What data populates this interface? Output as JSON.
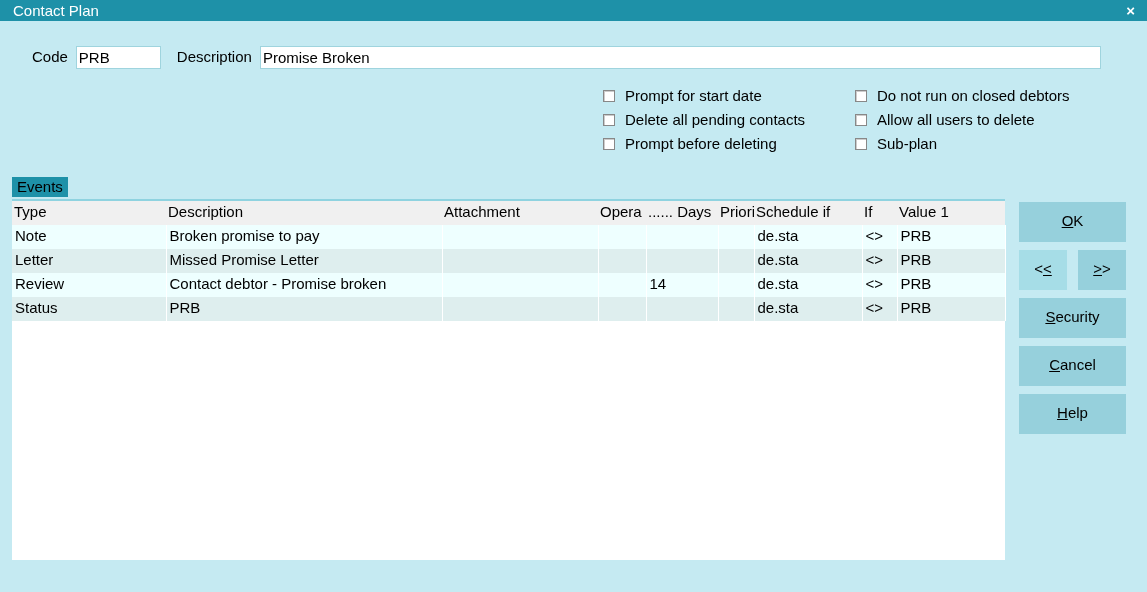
{
  "window": {
    "title": "Contact Plan",
    "close": "×"
  },
  "fields": [
    {
      "label": "Code",
      "value": "PRB"
    },
    {
      "label": "Description",
      "value": "Promise Broken"
    }
  ],
  "options": [
    [
      {
        "label": "Prompt for start date",
        "checked": false
      },
      {
        "label": "Delete all pending contacts",
        "checked": false
      },
      {
        "label": "Prompt before deleting",
        "checked": false
      }
    ],
    [
      {
        "label": "Do not run on closed debtors",
        "checked": false
      },
      {
        "label": "Allow all users to delete",
        "checked": false
      },
      {
        "label": "Sub-plan",
        "checked": false
      }
    ]
  ],
  "events": {
    "tab": "Events",
    "columns": [
      "Type",
      "Description",
      "Attachment",
      "Opera",
      "...... Days",
      "Priori",
      "Schedule if",
      "If",
      "Value 1"
    ],
    "rows": [
      [
        "Note",
        "Broken promise to pay",
        "",
        "",
        "",
        "",
        "de.sta",
        "<>",
        "PRB"
      ],
      [
        "Letter",
        "Missed Promise Letter",
        "",
        "",
        "",
        "",
        "de.sta",
        "<>",
        "PRB"
      ],
      [
        "Review",
        "Contact debtor - Promise broken",
        "",
        "",
        "14",
        "",
        "de.sta",
        "<>",
        "PRB"
      ],
      [
        "Status",
        "PRB",
        "",
        "",
        "",
        "",
        "de.sta",
        "<>",
        "PRB"
      ]
    ]
  },
  "buttons": [
    [
      {
        "key": "O",
        "after": "K"
      }
    ],
    [
      {
        "before": "<",
        "key": "<"
      },
      {
        "key": ">",
        "after": ">"
      }
    ],
    [
      {
        "key": "S",
        "after": "ecurity"
      }
    ],
    [
      {
        "key": "C",
        "after": "ancel"
      }
    ],
    [
      {
        "key": "H",
        "after": "elp"
      }
    ]
  ]
}
